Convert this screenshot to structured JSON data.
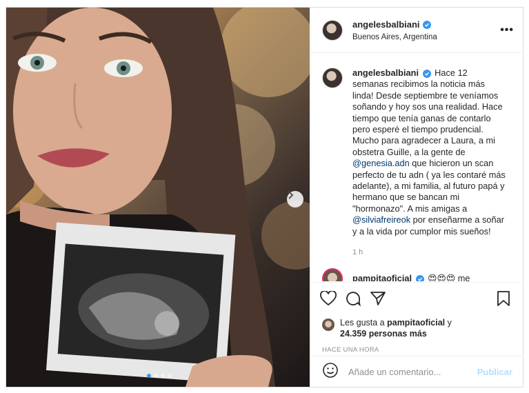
{
  "post": {
    "username": "angelesbalbiani",
    "location": "Buenos Aires, Argentina",
    "more_label": "•••",
    "carousel_next": "›",
    "carousel_slides": 4,
    "carousel_active": 1
  },
  "caption": {
    "username": "angelesbalbiani",
    "text_1": " Hace 12 semanas recibimos la noticia más linda! Desde septiembre te veníamos soñando y hoy sos una realidad. Hace tiempo que tenía ganas de contarlo pero esperé el tiempo prudencial. Mucho para agradecer a Laura, a mi obstetra Guille, a la gente de ",
    "mention_1": "@genesia.adn",
    "text_2": " que hicieron un scan perfecto de tu adn ( ya les contaré más adelante), a mi familia, al futuro papá y hermano que se bancan mi \"hormonazo\". A mis amigas a ",
    "mention_2": "@silviafreireok",
    "text_3": " por enseñarme a soñar y a la vida por cumplor mis sueños!",
    "time": "1 h"
  },
  "comment": {
    "username": "pampitaoficial",
    "emojis": "😍😍😍",
    "text": " me"
  },
  "likes": {
    "prefix": "Les gusta a ",
    "user": "pampitaoficial",
    "suffix": " y",
    "count": "24.359 personas más"
  },
  "timestamp": "HACE UNA HORA",
  "add_comment": {
    "placeholder": "Añade un comentario...",
    "publish_label": "Publicar"
  },
  "colors": {
    "accent": "#3897f0",
    "mention": "#00376b",
    "publish_disabled": "#b2dffc",
    "muted": "#8e8e8e"
  },
  "icons": [
    "heart-icon",
    "comment-icon",
    "share-icon",
    "bookmark-icon",
    "emoji-icon",
    "verified-icon",
    "more-icon",
    "chevron-right-icon"
  ]
}
